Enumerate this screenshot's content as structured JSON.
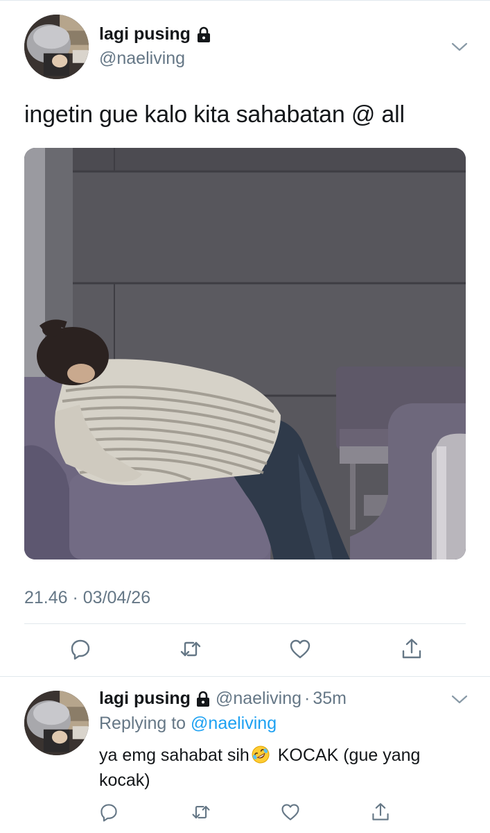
{
  "tweet": {
    "display_name": "lagi pusing",
    "handle": "@naeliving",
    "text": "ingetin gue kalo kita sahabatan @ all",
    "timestamp": "21.46 · 03/04/26"
  },
  "reply": {
    "display_name": "lagi pusing",
    "handle": "@naeliving",
    "separator": "·",
    "time": "35m",
    "replying_prefix": "Replying to",
    "replying_to": "@naeliving",
    "text_before_emoji": "ya emg sahabat sih",
    "emoji": "rolling-on-floor-laughing",
    "text_after_emoji": " KOCAK (gue yang kocak)"
  },
  "icons": {
    "lock": "lock-icon",
    "chevron": "chevron-down-icon",
    "reply": "reply-icon",
    "retweet": "retweet-icon",
    "like": "heart-icon",
    "share": "share-icon"
  },
  "colors": {
    "text": "#14171a",
    "secondary": "#657786",
    "link": "#1da1f2",
    "divider": "#e1e8ed",
    "icon": "#657786"
  }
}
